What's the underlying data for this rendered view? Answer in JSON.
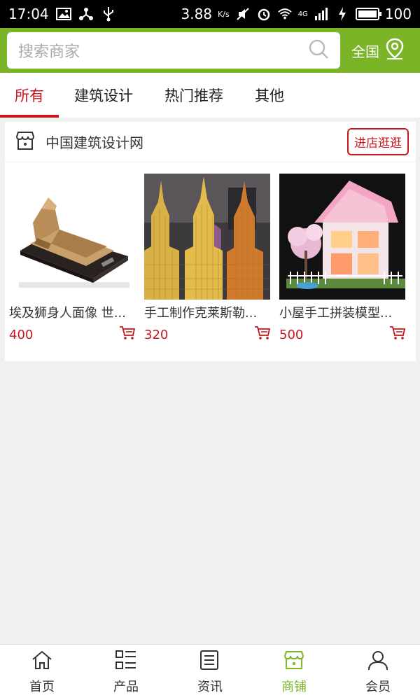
{
  "status_bar": {
    "time": "17:04",
    "speed": "3.88",
    "speed_unit": "K/s",
    "network": "4G",
    "battery": "100"
  },
  "header": {
    "search_placeholder": "搜索商家",
    "region_label": "全国"
  },
  "tabs": [
    {
      "label": "所有",
      "active": true
    },
    {
      "label": "建筑设计",
      "active": false
    },
    {
      "label": "热门推荐",
      "active": false
    },
    {
      "label": "其他",
      "active": false
    }
  ],
  "shop": {
    "name": "中国建筑设计网",
    "enter_label": "进店逛逛",
    "products": [
      {
        "name": "埃及狮身人面像 世...",
        "price": "400"
      },
      {
        "name": "手工制作克莱斯勒...",
        "price": "320"
      },
      {
        "name": "小屋手工拼装模型...",
        "price": "500"
      }
    ]
  },
  "bottom_nav": [
    {
      "label": "首页",
      "icon": "home-icon"
    },
    {
      "label": "产品",
      "icon": "product-list-icon"
    },
    {
      "label": "资讯",
      "icon": "news-icon"
    },
    {
      "label": "商铺",
      "icon": "shop-icon",
      "active": true
    },
    {
      "label": "会员",
      "icon": "user-icon"
    }
  ],
  "colors": {
    "brand_green": "#7cb428",
    "accent_red": "#c8161d"
  }
}
